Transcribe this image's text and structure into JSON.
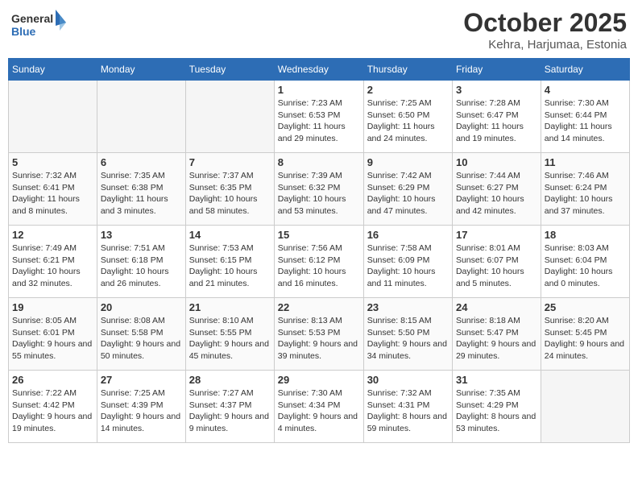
{
  "logo": {
    "line1": "General",
    "line2": "Blue"
  },
  "title": "October 2025",
  "location": "Kehra, Harjumaa, Estonia",
  "days_of_week": [
    "Sunday",
    "Monday",
    "Tuesday",
    "Wednesday",
    "Thursday",
    "Friday",
    "Saturday"
  ],
  "weeks": [
    [
      {
        "day": "",
        "info": ""
      },
      {
        "day": "",
        "info": ""
      },
      {
        "day": "",
        "info": ""
      },
      {
        "day": "1",
        "info": "Sunrise: 7:23 AM\nSunset: 6:53 PM\nDaylight: 11 hours and 29 minutes."
      },
      {
        "day": "2",
        "info": "Sunrise: 7:25 AM\nSunset: 6:50 PM\nDaylight: 11 hours and 24 minutes."
      },
      {
        "day": "3",
        "info": "Sunrise: 7:28 AM\nSunset: 6:47 PM\nDaylight: 11 hours and 19 minutes."
      },
      {
        "day": "4",
        "info": "Sunrise: 7:30 AM\nSunset: 6:44 PM\nDaylight: 11 hours and 14 minutes."
      }
    ],
    [
      {
        "day": "5",
        "info": "Sunrise: 7:32 AM\nSunset: 6:41 PM\nDaylight: 11 hours and 8 minutes."
      },
      {
        "day": "6",
        "info": "Sunrise: 7:35 AM\nSunset: 6:38 PM\nDaylight: 11 hours and 3 minutes."
      },
      {
        "day": "7",
        "info": "Sunrise: 7:37 AM\nSunset: 6:35 PM\nDaylight: 10 hours and 58 minutes."
      },
      {
        "day": "8",
        "info": "Sunrise: 7:39 AM\nSunset: 6:32 PM\nDaylight: 10 hours and 53 minutes."
      },
      {
        "day": "9",
        "info": "Sunrise: 7:42 AM\nSunset: 6:29 PM\nDaylight: 10 hours and 47 minutes."
      },
      {
        "day": "10",
        "info": "Sunrise: 7:44 AM\nSunset: 6:27 PM\nDaylight: 10 hours and 42 minutes."
      },
      {
        "day": "11",
        "info": "Sunrise: 7:46 AM\nSunset: 6:24 PM\nDaylight: 10 hours and 37 minutes."
      }
    ],
    [
      {
        "day": "12",
        "info": "Sunrise: 7:49 AM\nSunset: 6:21 PM\nDaylight: 10 hours and 32 minutes."
      },
      {
        "day": "13",
        "info": "Sunrise: 7:51 AM\nSunset: 6:18 PM\nDaylight: 10 hours and 26 minutes."
      },
      {
        "day": "14",
        "info": "Sunrise: 7:53 AM\nSunset: 6:15 PM\nDaylight: 10 hours and 21 minutes."
      },
      {
        "day": "15",
        "info": "Sunrise: 7:56 AM\nSunset: 6:12 PM\nDaylight: 10 hours and 16 minutes."
      },
      {
        "day": "16",
        "info": "Sunrise: 7:58 AM\nSunset: 6:09 PM\nDaylight: 10 hours and 11 minutes."
      },
      {
        "day": "17",
        "info": "Sunrise: 8:01 AM\nSunset: 6:07 PM\nDaylight: 10 hours and 5 minutes."
      },
      {
        "day": "18",
        "info": "Sunrise: 8:03 AM\nSunset: 6:04 PM\nDaylight: 10 hours and 0 minutes."
      }
    ],
    [
      {
        "day": "19",
        "info": "Sunrise: 8:05 AM\nSunset: 6:01 PM\nDaylight: 9 hours and 55 minutes."
      },
      {
        "day": "20",
        "info": "Sunrise: 8:08 AM\nSunset: 5:58 PM\nDaylight: 9 hours and 50 minutes."
      },
      {
        "day": "21",
        "info": "Sunrise: 8:10 AM\nSunset: 5:55 PM\nDaylight: 9 hours and 45 minutes."
      },
      {
        "day": "22",
        "info": "Sunrise: 8:13 AM\nSunset: 5:53 PM\nDaylight: 9 hours and 39 minutes."
      },
      {
        "day": "23",
        "info": "Sunrise: 8:15 AM\nSunset: 5:50 PM\nDaylight: 9 hours and 34 minutes."
      },
      {
        "day": "24",
        "info": "Sunrise: 8:18 AM\nSunset: 5:47 PM\nDaylight: 9 hours and 29 minutes."
      },
      {
        "day": "25",
        "info": "Sunrise: 8:20 AM\nSunset: 5:45 PM\nDaylight: 9 hours and 24 minutes."
      }
    ],
    [
      {
        "day": "26",
        "info": "Sunrise: 7:22 AM\nSunset: 4:42 PM\nDaylight: 9 hours and 19 minutes."
      },
      {
        "day": "27",
        "info": "Sunrise: 7:25 AM\nSunset: 4:39 PM\nDaylight: 9 hours and 14 minutes."
      },
      {
        "day": "28",
        "info": "Sunrise: 7:27 AM\nSunset: 4:37 PM\nDaylight: 9 hours and 9 minutes."
      },
      {
        "day": "29",
        "info": "Sunrise: 7:30 AM\nSunset: 4:34 PM\nDaylight: 9 hours and 4 minutes."
      },
      {
        "day": "30",
        "info": "Sunrise: 7:32 AM\nSunset: 4:31 PM\nDaylight: 8 hours and 59 minutes."
      },
      {
        "day": "31",
        "info": "Sunrise: 7:35 AM\nSunset: 4:29 PM\nDaylight: 8 hours and 53 minutes."
      },
      {
        "day": "",
        "info": ""
      }
    ]
  ]
}
